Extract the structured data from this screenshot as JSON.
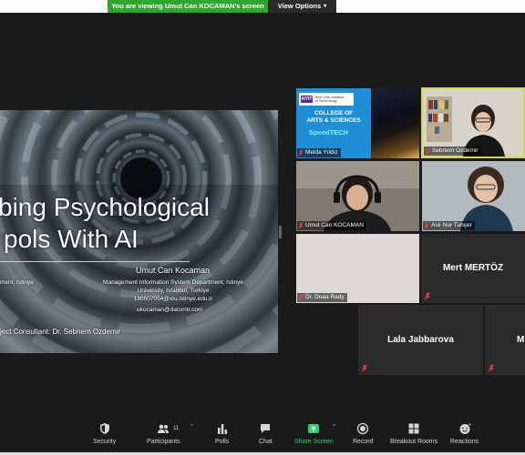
{
  "banner": {
    "viewing_text": "You are viewing Umut Can KOCAMAN's screen",
    "view_options_label": "View Options",
    "banner_color": "#2fa62f"
  },
  "slide": {
    "title_line1": "bing Psychological",
    "title_line2": "pols With AI",
    "author": "Umut Can Kocaman",
    "dept_left": "ment, Istinye",
    "affiliation_line1": "Management Information System Department, Istinye",
    "affiliation_line2": "University, Istanbul, Turkiye",
    "affiliation_line3": "180507054@stu.istinye.edu.tr",
    "email": "ukocaman@datumtr.com",
    "consultant": "ject Consultant: Dr. Sebnem Ozdemir"
  },
  "participants": [
    {
      "name": "Melda Yıldız",
      "muted": true
    },
    {
      "name": "Sebnem Ozdemir",
      "muted": true,
      "active_speaker": true
    },
    {
      "name": "Umut Can KOCAMAN",
      "muted": true
    },
    {
      "name": "Aslı Nur Tunçer",
      "muted": true
    },
    {
      "name": "Dr. Doaa Rady",
      "muted": true
    },
    {
      "name": "Mert MERTÖZ",
      "muted": true
    },
    {
      "name": "Lala Jabbarova",
      "muted": true
    },
    {
      "name": "M",
      "muted": true
    }
  ],
  "melda_background": {
    "nyit_logo": "NYIT",
    "nyit_text": "New York Institute of Technology",
    "college_line1": "COLLEGE OF",
    "college_line2": "ARTS & SCIENCES",
    "speedtech": "SpeedTECH"
  },
  "toolbar": {
    "security": "Security",
    "participants": "Participants",
    "participants_count": "11",
    "polls": "Polls",
    "chat": "Chat",
    "share_screen": "Share Screen",
    "record": "Record",
    "breakout_rooms": "Breakout Rooms",
    "reactions": "Reactions",
    "share_color": "#2fd26b"
  }
}
